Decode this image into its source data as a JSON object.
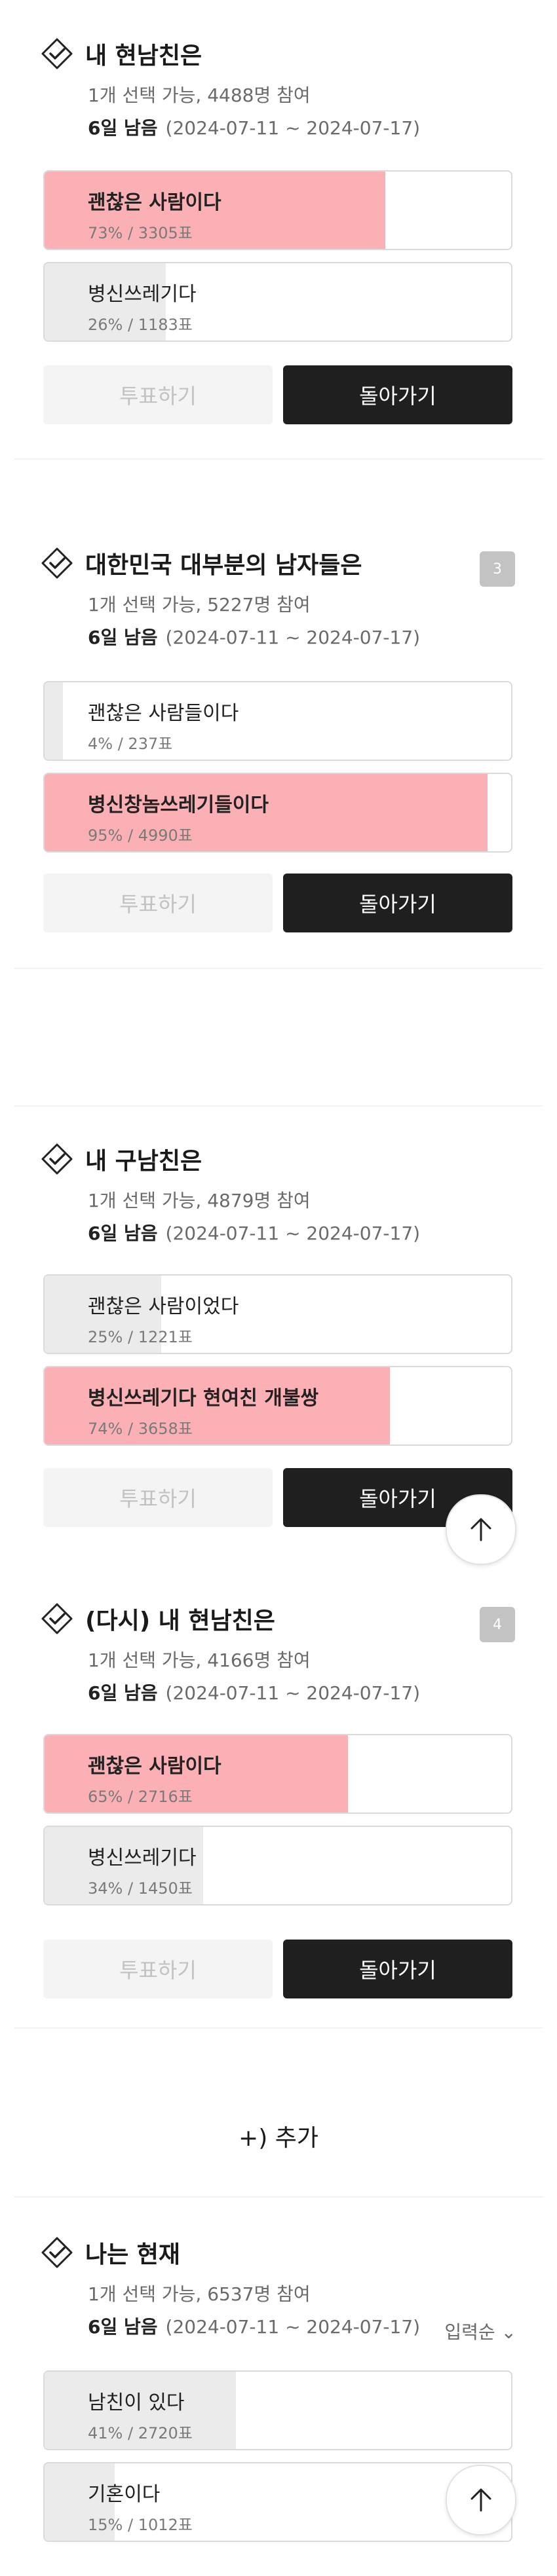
{
  "polls": [
    {
      "title": "내 현남친은",
      "meta": "1개 선택 가능, 4488명 참여",
      "days_left": "6일 남음",
      "period": "(2024-07-11 ~ 2024-07-17)",
      "options": [
        {
          "label": "괜찮은 사람이다",
          "stat": "73% / 3305표",
          "percent": 73,
          "selected": true
        },
        {
          "label": "병신쓰레기다",
          "stat": "26% / 1183표",
          "percent": 26,
          "selected": false
        }
      ],
      "vote_label": "투표하기",
      "back_label": "돌아가기"
    },
    {
      "title": "대한민국 대부분의 남자들은",
      "badge": "3",
      "meta": "1개 선택 가능, 5227명 참여",
      "days_left": "6일 남음",
      "period": "(2024-07-11 ~ 2024-07-17)",
      "options": [
        {
          "label": "괜찮은 사람들이다",
          "stat": "4% / 237표",
          "percent": 4,
          "selected": false
        },
        {
          "label": "병신창놈쓰레기들이다",
          "stat": "95% / 4990표",
          "percent": 95,
          "selected": true
        }
      ],
      "vote_label": "투표하기",
      "back_label": "돌아가기"
    },
    {
      "title": "내 구남친은",
      "meta": "1개 선택 가능, 4879명 참여",
      "days_left": "6일 남음",
      "period": "(2024-07-11 ~ 2024-07-17)",
      "options": [
        {
          "label": "괜찮은 사람이었다",
          "stat": "25% / 1221표",
          "percent": 25,
          "selected": false
        },
        {
          "label": "병신쓰레기다 현여친 개불쌍",
          "stat": "74% / 3658표",
          "percent": 74,
          "selected": true
        }
      ],
      "vote_label": "투표하기",
      "back_label": "돌아가기"
    },
    {
      "title": "(다시) 내 현남친은",
      "badge": "4",
      "meta": "1개 선택 가능, 4166명 참여",
      "days_left": "6일 남음",
      "period": "(2024-07-11 ~ 2024-07-17)",
      "options": [
        {
          "label": "괜찮은 사람이다",
          "stat": "65% / 2716표",
          "percent": 65,
          "selected": true
        },
        {
          "label": "병신쓰레기다",
          "stat": "34% / 1450표",
          "percent": 34,
          "selected": false
        }
      ],
      "vote_label": "투표하기",
      "back_label": "돌아가기"
    },
    {
      "title": "나는 현재",
      "meta": "1개 선택 가능, 6537명 참여",
      "days_left": "6일 남음",
      "period": "(2024-07-11 ~ 2024-07-17)",
      "sort_label": "입력순 ⌄",
      "options": [
        {
          "label": "남친이 있다",
          "stat": "41% / 2720표",
          "percent": 41,
          "selected": false
        },
        {
          "label": "기혼이다",
          "stat": "15% / 1012표",
          "percent": 15,
          "selected": false
        }
      ]
    }
  ],
  "add_label": "+) 추가",
  "icons": {
    "poll": "check-box-icon",
    "scroll_top": "arrow-up-icon"
  },
  "colors": {
    "selected_fill": "#fbb0b5",
    "bar_fill": "#ebebeb",
    "back_button": "#1f1f1f",
    "vote_button": "#f4f4f4"
  }
}
